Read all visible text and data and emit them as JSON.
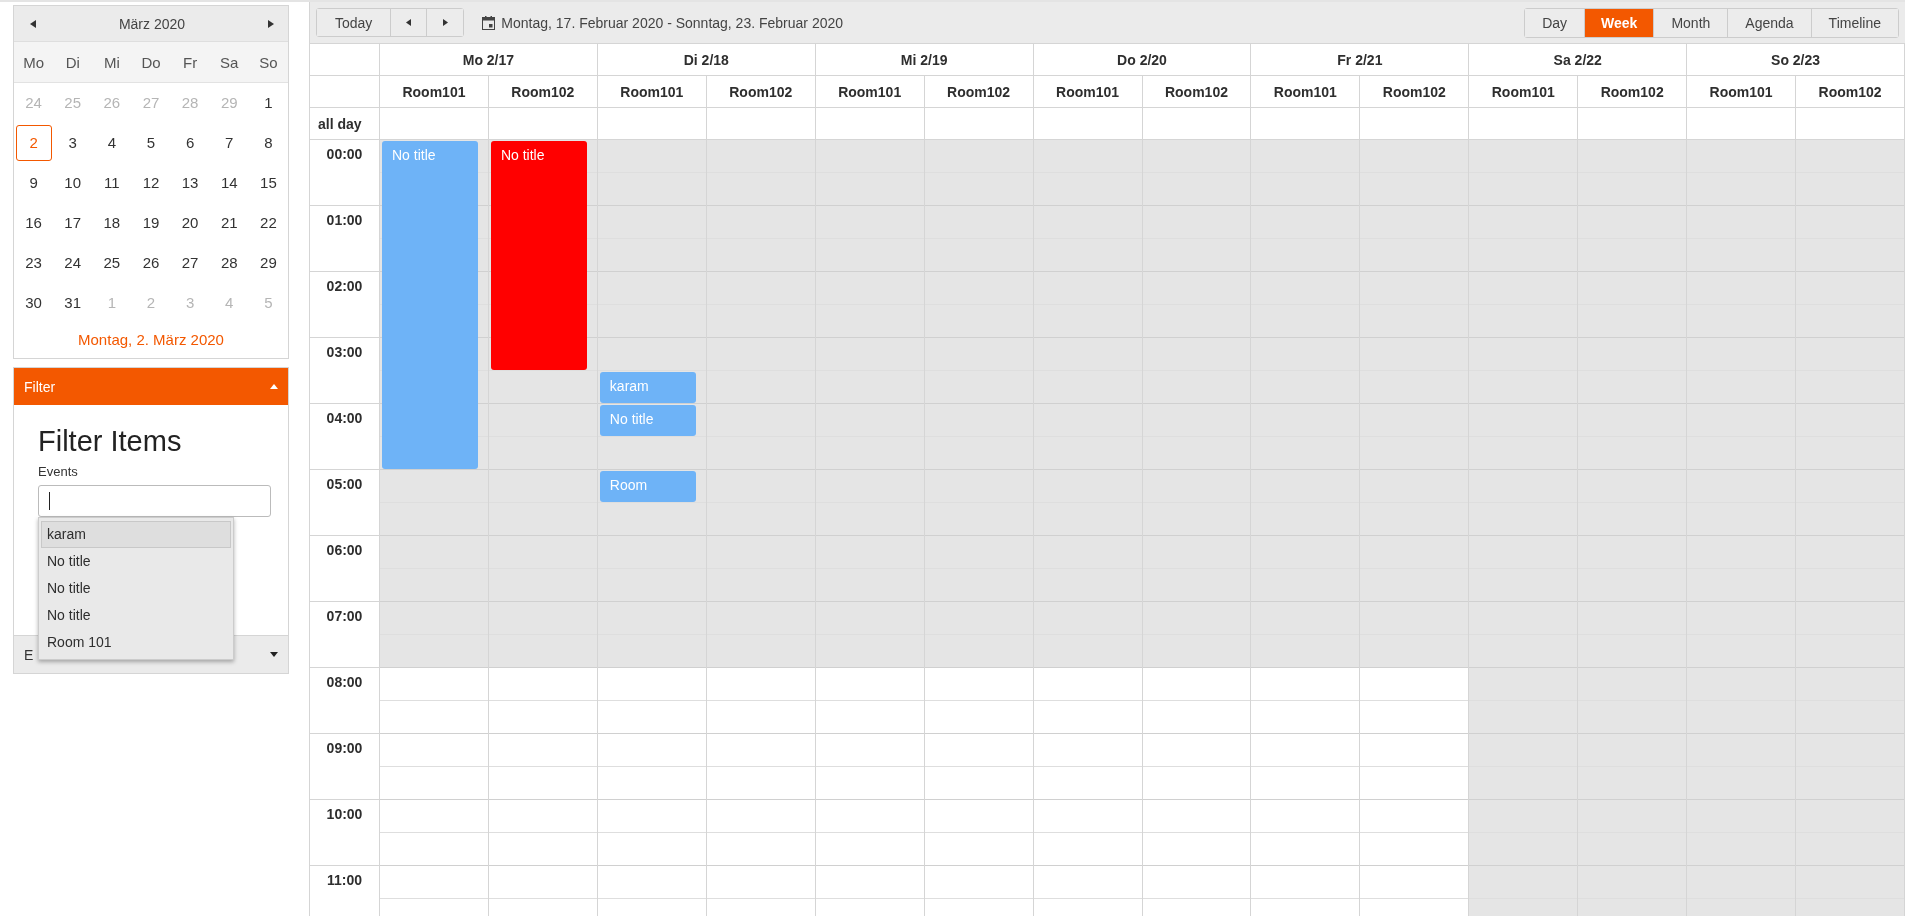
{
  "mini_calendar": {
    "month": "März 2020",
    "weekdays": [
      "Mo",
      "Di",
      "Mi",
      "Do",
      "Fr",
      "Sa",
      "So"
    ],
    "weeks": [
      [
        {
          "day": "24",
          "other_month": true,
          "selected": false
        },
        {
          "day": "25",
          "other_month": true,
          "selected": false
        },
        {
          "day": "26",
          "other_month": true,
          "selected": false
        },
        {
          "day": "27",
          "other_month": true,
          "selected": false
        },
        {
          "day": "28",
          "other_month": true,
          "selected": false
        },
        {
          "day": "29",
          "other_month": true,
          "selected": false
        },
        {
          "day": "1",
          "other_month": false,
          "selected": false
        }
      ],
      [
        {
          "day": "2",
          "other_month": false,
          "selected": true
        },
        {
          "day": "3",
          "other_month": false,
          "selected": false
        },
        {
          "day": "4",
          "other_month": false,
          "selected": false
        },
        {
          "day": "5",
          "other_month": false,
          "selected": false
        },
        {
          "day": "6",
          "other_month": false,
          "selected": false
        },
        {
          "day": "7",
          "other_month": false,
          "selected": false
        },
        {
          "day": "8",
          "other_month": false,
          "selected": false
        }
      ],
      [
        {
          "day": "9",
          "other_month": false,
          "selected": false
        },
        {
          "day": "10",
          "other_month": false,
          "selected": false
        },
        {
          "day": "11",
          "other_month": false,
          "selected": false
        },
        {
          "day": "12",
          "other_month": false,
          "selected": false
        },
        {
          "day": "13",
          "other_month": false,
          "selected": false
        },
        {
          "day": "14",
          "other_month": false,
          "selected": false
        },
        {
          "day": "15",
          "other_month": false,
          "selected": false
        }
      ],
      [
        {
          "day": "16",
          "other_month": false,
          "selected": false
        },
        {
          "day": "17",
          "other_month": false,
          "selected": false
        },
        {
          "day": "18",
          "other_month": false,
          "selected": false
        },
        {
          "day": "19",
          "other_month": false,
          "selected": false
        },
        {
          "day": "20",
          "other_month": false,
          "selected": false
        },
        {
          "day": "21",
          "other_month": false,
          "selected": false
        },
        {
          "day": "22",
          "other_month": false,
          "selected": false
        }
      ],
      [
        {
          "day": "23",
          "other_month": false,
          "selected": false
        },
        {
          "day": "24",
          "other_month": false,
          "selected": false
        },
        {
          "day": "25",
          "other_month": false,
          "selected": false
        },
        {
          "day": "26",
          "other_month": false,
          "selected": false
        },
        {
          "day": "27",
          "other_month": false,
          "selected": false
        },
        {
          "day": "28",
          "other_month": false,
          "selected": false
        },
        {
          "day": "29",
          "other_month": false,
          "selected": false
        }
      ],
      [
        {
          "day": "30",
          "other_month": false,
          "selected": false
        },
        {
          "day": "31",
          "other_month": false,
          "selected": false
        },
        {
          "day": "1",
          "other_month": true,
          "selected": false
        },
        {
          "day": "2",
          "other_month": true,
          "selected": false
        },
        {
          "day": "3",
          "other_month": true,
          "selected": false
        },
        {
          "day": "4",
          "other_month": true,
          "selected": false
        },
        {
          "day": "5",
          "other_month": true,
          "selected": false
        }
      ]
    ],
    "footer": "Montag, 2. März 2020"
  },
  "panels": [
    {
      "title": "Filter",
      "expanded": true,
      "heading": "Filter Items",
      "field_label": "Events",
      "dropdown": [
        {
          "label": "karam",
          "selected": true
        },
        {
          "label": "No title",
          "selected": false
        },
        {
          "label": "No title",
          "selected": false
        },
        {
          "label": "No title",
          "selected": false
        },
        {
          "label": "Room 101",
          "selected": false
        }
      ]
    },
    {
      "title": "E",
      "expanded": false
    }
  ],
  "toolbar": {
    "today": "Today",
    "date_range": "Montag, 17. Februar 2020 - Sonntag, 23. Februar 2020",
    "views": [
      {
        "label": "Day",
        "selected": false
      },
      {
        "label": "Week",
        "selected": true
      },
      {
        "label": "Month",
        "selected": false
      },
      {
        "label": "Agenda",
        "selected": false
      },
      {
        "label": "Timeline",
        "selected": false
      }
    ]
  },
  "all_day_label": "all day",
  "hours": [
    {
      "label": "00:00",
      "business": false
    },
    {
      "label": "01:00",
      "business": false
    },
    {
      "label": "02:00",
      "business": false
    },
    {
      "label": "03:00",
      "business": false
    },
    {
      "label": "04:00",
      "business": false
    },
    {
      "label": "05:00",
      "business": false
    },
    {
      "label": "06:00",
      "business": false
    },
    {
      "label": "07:00",
      "business": false
    },
    {
      "label": "08:00",
      "business": true
    },
    {
      "label": "09:00",
      "business": true
    },
    {
      "label": "10:00",
      "business": true
    },
    {
      "label": "11:00",
      "business": true
    }
  ],
  "days": [
    {
      "label": "Mo 2/17",
      "weekend": false,
      "rooms": [
        {
          "label": "Room101",
          "events": [
            {
              "title": "No title",
              "color": "#6eb3f7"
            }
          ]
        },
        {
          "label": "Room102",
          "events": [
            {
              "title": "No title",
              "color": "#ff0000"
            }
          ]
        }
      ]
    },
    {
      "label": "Di 2/18",
      "weekend": false,
      "rooms": [
        {
          "label": "Room101",
          "events": [
            {
              "title": "karam",
              "color": "#6eb3f7"
            },
            {
              "title": "No title",
              "color": "#6eb3f7"
            },
            {
              "title": "Room",
              "color": "#6eb3f7"
            }
          ]
        },
        {
          "label": "Room102"
        }
      ]
    },
    {
      "label": "Mi 2/19",
      "weekend": false,
      "rooms": [
        {
          "label": "Room101"
        },
        {
          "label": "Room102"
        }
      ]
    },
    {
      "label": "Do 2/20",
      "weekend": false,
      "rooms": [
        {
          "label": "Room101"
        },
        {
          "label": "Room102"
        }
      ]
    },
    {
      "label": "Fr 2/21",
      "weekend": false,
      "rooms": [
        {
          "label": "Room101"
        },
        {
          "label": "Room102"
        }
      ]
    },
    {
      "label": "Sa 2/22",
      "weekend": true,
      "rooms": [
        {
          "label": "Room101"
        },
        {
          "label": "Room102"
        }
      ]
    },
    {
      "label": "So 2/23",
      "weekend": true,
      "rooms": [
        {
          "label": "Room101"
        },
        {
          "label": "Room102"
        }
      ]
    }
  ]
}
